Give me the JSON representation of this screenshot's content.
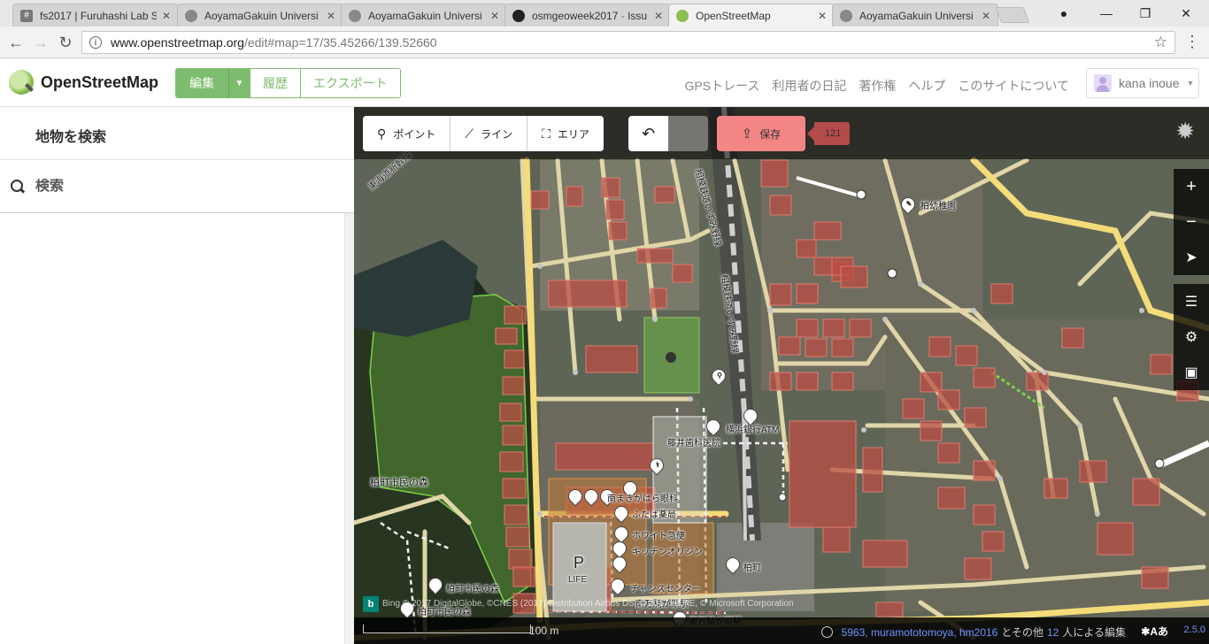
{
  "browser": {
    "tabs": [
      {
        "title": "fs2017 | Furuhashi Lab S",
        "favicon": "#"
      },
      {
        "title": "AoyamaGakuin Universi",
        "favicon": "o"
      },
      {
        "title": "AoyamaGakuin Universi",
        "favicon": "o"
      },
      {
        "title": "osmgeoweek2017 · Issu",
        "favicon": "gh"
      },
      {
        "title": "OpenStreetMap",
        "favicon": "osm"
      },
      {
        "title": "AoyamaGakuin Universi",
        "favicon": "o"
      }
    ],
    "url_host": "www.openstreetmap.org",
    "url_path": "/edit#map=17/35.45266/139.52660"
  },
  "osm": {
    "site_name": "OpenStreetMap",
    "edit_label": "編集",
    "history_label": "履歴",
    "export_label": "エクスポート",
    "nav_links": [
      "GPSトレース",
      "利用者の日記",
      "著作権",
      "ヘルプ",
      "このサイトについて"
    ],
    "username": "kana inoue"
  },
  "sidebar": {
    "title": "地物を検索",
    "search_placeholder": "検索"
  },
  "editor": {
    "modes": {
      "point": "ポイント",
      "line": "ライン",
      "area": "エリア"
    },
    "save_label": "保存",
    "change_count": "121",
    "scale_label": "100 m",
    "attribution": "Bing  © 2017 DigitalGlobe, ©CNES (2017) Distribution Airbus DS, © 2017 HERE, © Microsoft Corporation",
    "history_users": "5963, muramototomoya, hm2016",
    "history_mid": "とその他",
    "history_count": "12",
    "history_tail": "人による編集",
    "version": "2.5.0"
  },
  "map_labels": {
    "kindergarten": "柏幼稚園",
    "railway1": "相模鉄道いずみ野線",
    "railway2": "相模鉄道いずみ野線",
    "road_top": "東海道新幹線",
    "atm": "横浜銀行ATM",
    "dental": "藤井歯科医院",
    "forest": "柏町市民の森",
    "eye_clinic": "南まきがはら眼科",
    "pharmacy": "ふたば薬局",
    "courier": "ホワイト急便",
    "kitchen": "キッチンオリジン",
    "parking_p": "P",
    "parking_name": "LIFE",
    "center": "チャンスセンター",
    "station": "南万騎が原駅",
    "peak": "柏町",
    "forest_info1": "柏町市民の森",
    "forest_info2": "柏町市民の森"
  },
  "colors": {
    "osm_green": "#7ebc6f",
    "save_red": "#f48585",
    "link_blue": "#7092ff"
  }
}
